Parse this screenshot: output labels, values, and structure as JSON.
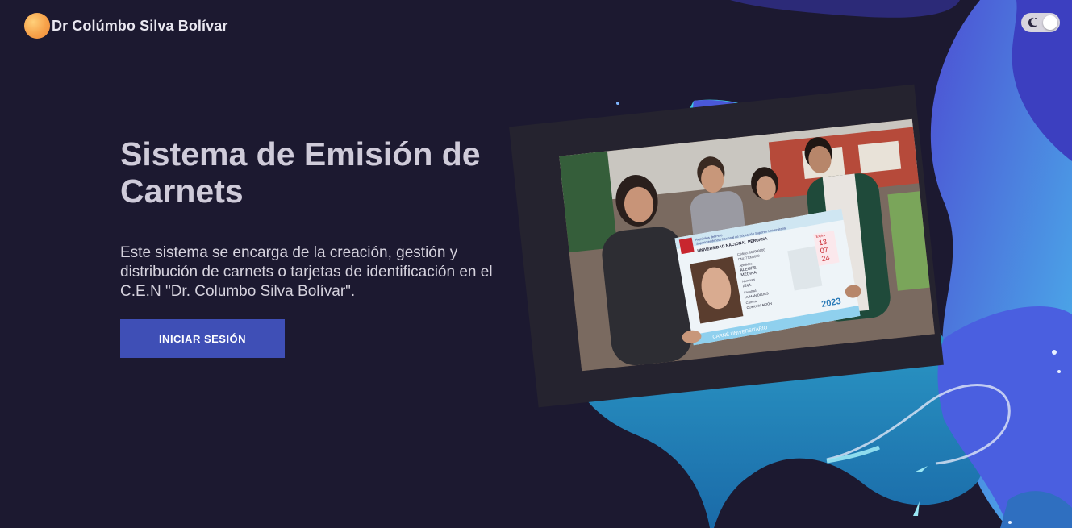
{
  "header": {
    "brand_name": "Dr Colúmbo Silva Bolívar",
    "logo_icon": "orange-circle-logo"
  },
  "theme_toggle": {
    "icon": "moon-icon",
    "state": "dark"
  },
  "hero": {
    "title": "Sistema de Emisión de Carnets",
    "description": "Este sistema se encarga de la creación, gestión y distribución de carnets o tarjetas de identificación en el C.E.N \"Dr. Columbo Silva Bolívar\".",
    "cta_label": "INICIAR SESIÓN"
  },
  "photo": {
    "card_header_1": "República del Perú",
    "card_header_2": "Superintendencia Nacional de Educación Superior Universitaria",
    "card_university": "UNIVERSIDAD NACIONAL PERUANA",
    "card_fields": [
      "Código: 000000000",
      "DNI: 77000000",
      "Apellidos",
      "ALEGRE",
      "MEDINA",
      "Nombres",
      "ANA",
      "Facultad",
      "HUMANIDADES",
      "Carrera",
      "COMUNICACIÓN"
    ],
    "card_expiry_label": "Expira",
    "card_expiry": [
      "13",
      "07",
      "24"
    ],
    "card_year": "2023",
    "card_footer": "CARNÉ UNIVERSITARIO"
  },
  "colors": {
    "background": "#1c1930",
    "button": "#3f4fb6",
    "accent_blue": "#4a5fe0",
    "accent_cyan": "#4fc3e8",
    "logo_orange": "#f7a24a"
  }
}
